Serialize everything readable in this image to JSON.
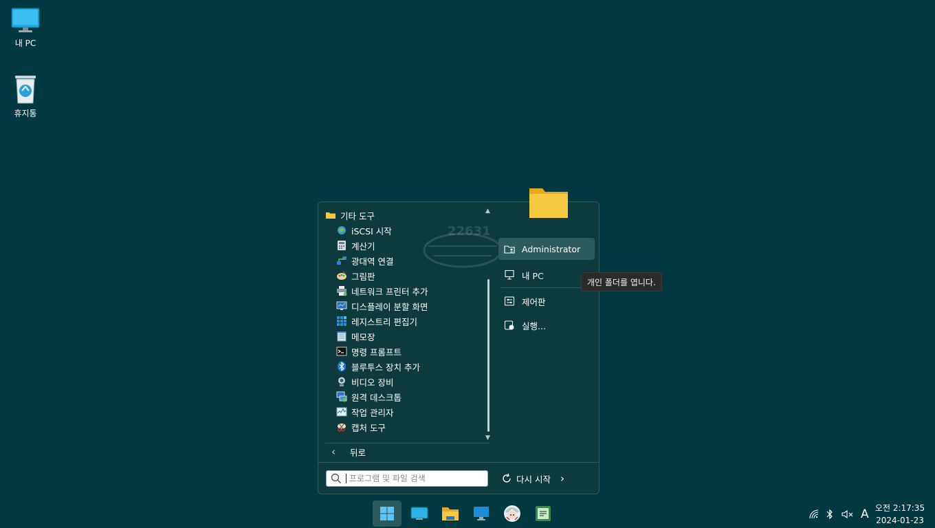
{
  "desktop": {
    "icons": [
      {
        "label": "내 PC"
      },
      {
        "label": "휴지통"
      }
    ]
  },
  "start_menu": {
    "folder_label": "기타 도구",
    "items": [
      {
        "label": "iSCSI 시작"
      },
      {
        "label": "계산기"
      },
      {
        "label": "광대역 연결"
      },
      {
        "label": "그림판"
      },
      {
        "label": "네트워크 프린터 추가"
      },
      {
        "label": "디스플레이 분할 화면"
      },
      {
        "label": "레지스트리 편집기"
      },
      {
        "label": "메모장"
      },
      {
        "label": "명령 프롬프트"
      },
      {
        "label": "블루투스 장치 추가"
      },
      {
        "label": "비디오 장비"
      },
      {
        "label": "원격 데스크톱"
      },
      {
        "label": "작업 관리자"
      },
      {
        "label": "캡처 도구"
      }
    ],
    "back_label": "뒤로",
    "search_placeholder": "프로그램 및 파일 검색",
    "restart_label": "다시 시작",
    "right_items": [
      {
        "label": "Administrator"
      },
      {
        "label": "내 PC"
      },
      {
        "label": "제어판"
      },
      {
        "label": "실행..."
      }
    ],
    "watermark": "22631"
  },
  "tooltip": "개인 폴더를 엽니다.",
  "tray": {
    "ime": "A",
    "time": "오전 2:17:35",
    "date": "2024-01-23"
  },
  "colors": {
    "desktop_bg": "#003a40",
    "menu_bg": "#0d3a3c",
    "highlight": "#2c5b5e",
    "folder_yellow": "#f6c940"
  }
}
